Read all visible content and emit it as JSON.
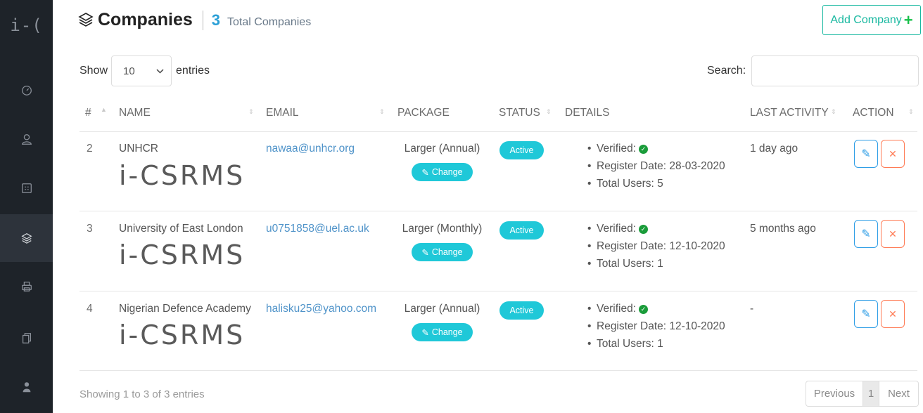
{
  "sidebar": {
    "logo": "i-(",
    "items": [
      {
        "icon": "dashboard-icon"
      },
      {
        "icon": "user-icon"
      },
      {
        "icon": "calculator-icon"
      },
      {
        "icon": "layers-icon",
        "active": true
      },
      {
        "icon": "print-icon"
      },
      {
        "icon": "documents-icon"
      },
      {
        "icon": "person-icon"
      }
    ]
  },
  "header": {
    "title": "Companies",
    "total_count": "3",
    "total_label": "Total Companies",
    "add_button_label": "Add Company"
  },
  "controls": {
    "show_label": "Show",
    "entries_value": "10",
    "entries_label": "entries",
    "search_label": "Search:"
  },
  "table": {
    "columns": [
      "#",
      "NAME",
      "EMAIL",
      "PACKAGE",
      "STATUS",
      "DETAILS",
      "LAST ACTIVITY",
      "ACTION"
    ],
    "rows": [
      {
        "num": "2",
        "name": "UNHCR",
        "logo": "i-CSRMS",
        "email": "nawaa@unhcr.org",
        "package": "Larger (Annual)",
        "change_label": "Change",
        "status": "Active",
        "verified": "Verified:",
        "register": "Register Date: 28-03-2020",
        "users": "Total Users: 5",
        "last_activity": "1 day ago"
      },
      {
        "num": "3",
        "name": "University of East London",
        "logo": "i-CSRMS",
        "email": "u0751858@uel.ac.uk",
        "package": "Larger (Monthly)",
        "change_label": "Change",
        "status": "Active",
        "verified": "Verified:",
        "register": "Register Date: 12-10-2020",
        "users": "Total Users: 1",
        "last_activity": "5 months ago"
      },
      {
        "num": "4",
        "name": "Nigerian Defence Academy",
        "logo": "i-CSRMS",
        "email": "halisku25@yahoo.com",
        "package": "Larger (Annual)",
        "change_label": "Change",
        "status": "Active",
        "verified": "Verified:",
        "register": "Register Date: 12-10-2020",
        "users": "Total Users: 1",
        "last_activity": "-"
      }
    ]
  },
  "footer": {
    "info": "Showing 1 to 3 of 3 entries",
    "prev": "Previous",
    "page": "1",
    "next": "Next"
  },
  "colors": {
    "accent": "#1fc8d8",
    "link": "#4f93c9",
    "success": "#1a9c3a",
    "danger": "#ff7b55",
    "sidebar": "#1e2329"
  }
}
